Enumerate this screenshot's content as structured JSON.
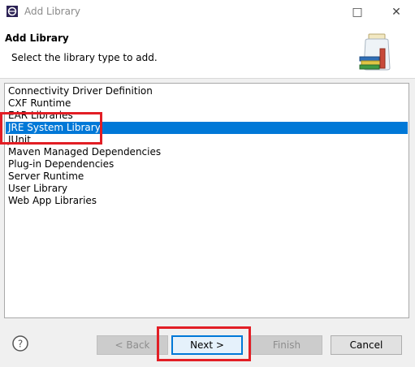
{
  "window": {
    "title": "Add Library",
    "minimize_glyph": "□",
    "close_glyph": "✕"
  },
  "banner": {
    "title": "Add Library",
    "description": "Select the library type to add.",
    "icon": "library-jar-books-icon"
  },
  "library_types": {
    "selected_index": 3,
    "items": [
      {
        "label": "Connectivity Driver Definition"
      },
      {
        "label": "CXF Runtime"
      },
      {
        "label": "EAR Libraries"
      },
      {
        "label": "JRE System Library"
      },
      {
        "label": "JUnit"
      },
      {
        "label": "Maven Managed Dependencies"
      },
      {
        "label": "Plug-in Dependencies"
      },
      {
        "label": "Server Runtime"
      },
      {
        "label": "User Library"
      },
      {
        "label": "Web App Libraries"
      }
    ]
  },
  "footer": {
    "help_icon": "help-icon",
    "help_glyph": "?",
    "back_label": "< Back",
    "next_label": "Next >",
    "finish_label": "Finish",
    "cancel_label": "Cancel"
  },
  "colors": {
    "selection": "#0078d7",
    "highlight_annotation": "#e21e25"
  }
}
